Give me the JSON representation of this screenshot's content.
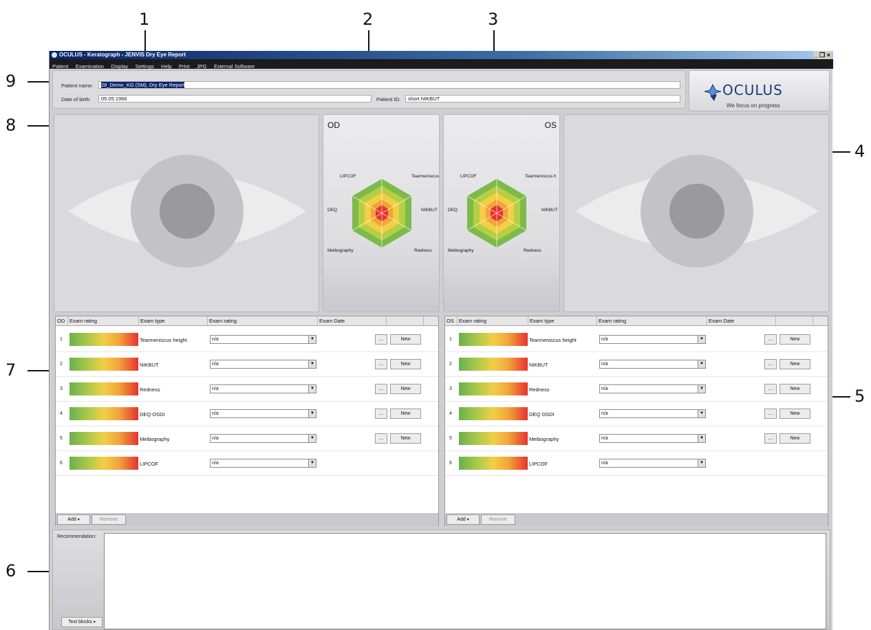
{
  "callouts": [
    "1",
    "2",
    "3",
    "4",
    "5",
    "6",
    "7",
    "8",
    "9"
  ],
  "window": {
    "title": "OCULUS - Keratograph - JENVIS Dry Eye Report",
    "controls": "_ ❒ ×"
  },
  "menu": [
    "Patient",
    "Examination",
    "Display",
    "Settings",
    "Help",
    "Print",
    "JPG",
    "External Software"
  ],
  "patient": {
    "name_label": "Patient name:",
    "name_value": "28_Demo_KG (SM), Dry Eye Report",
    "dob_label": "Date of birth:",
    "dob_value": "05.05.1966",
    "id_label": "Patient ID:",
    "id_value": "short NIKBUT"
  },
  "logo": {
    "brand": "OCULUS",
    "tagline": "We focus on progress"
  },
  "radar": {
    "od_title": "OD",
    "os_title": "OS",
    "labels": {
      "top_left": "LIPCOF",
      "top_right": "Tearmeniscus h",
      "mid_left": "DEQ",
      "mid_right": "NIKBUT",
      "bottom_left": "Meibography",
      "bottom_right": "Redness"
    }
  },
  "exam_table": {
    "od_header": [
      "OD",
      "Exam rating",
      "Exam type",
      "Exam rating",
      "Exam Date",
      ""
    ],
    "os_header": [
      "OS",
      "Exam rating",
      "Exam type",
      "Exam rating",
      "Exam Date",
      ""
    ],
    "rows": [
      {
        "num": "1",
        "type": "Tearmeniscus height",
        "value": "n/a",
        "has_buttons": true
      },
      {
        "num": "2",
        "type": "NIKBUT",
        "value": "n/a",
        "has_buttons": true
      },
      {
        "num": "3",
        "type": "Redness",
        "value": "n/a",
        "has_buttons": true
      },
      {
        "num": "4",
        "type": "DEQ OSDI",
        "value": "n/a",
        "has_buttons": true
      },
      {
        "num": "5",
        "type": "Meibography",
        "value": "n/a",
        "has_buttons": true
      },
      {
        "num": "6",
        "type": "LIPCOF",
        "value": "n/a",
        "has_buttons": false
      }
    ],
    "dots_label": "...",
    "new_label": "New",
    "add_label": "Add",
    "remove_label": "Remove"
  },
  "recommendation": {
    "label": "Recommendation:",
    "text_blocks_label": "Text blocks"
  }
}
